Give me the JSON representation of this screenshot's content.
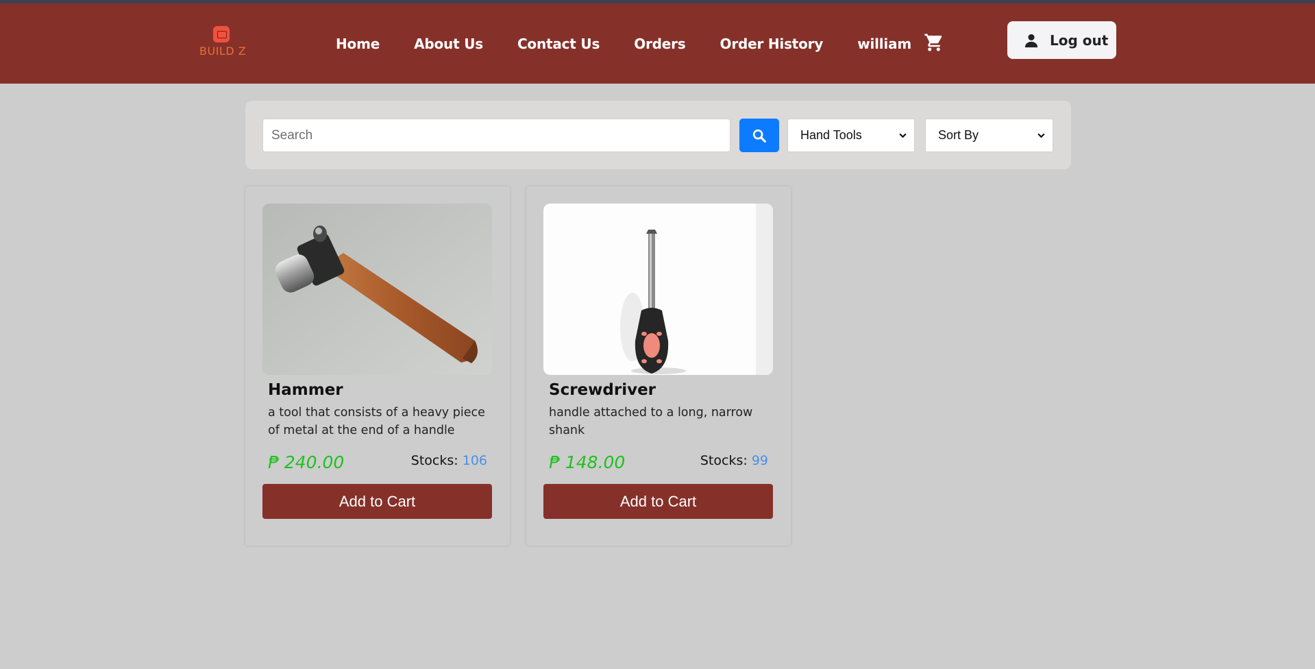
{
  "app": {
    "brand": "BUILD Z",
    "colors": {
      "navbar": "#85312a",
      "background": "#cdcdcd",
      "accent": "#0d7bff",
      "price": "#1fc11f",
      "stock_value": "#4b8fe8"
    }
  },
  "nav": {
    "links": [
      "Home",
      "About Us",
      "Contact Us",
      "Orders",
      "Order History",
      "william"
    ],
    "cart_icon": "cart-icon",
    "logout": {
      "icon": "user-icon",
      "label": "Log out"
    }
  },
  "filters": {
    "search_placeholder": "Search",
    "search_value": "",
    "search_icon": "search-icon",
    "category": "Hand Tools",
    "sort": "Sort By"
  },
  "products": [
    {
      "name": "Hammer",
      "description": "a tool that consists of a heavy piece of metal at the end of a handle",
      "price": "₱ 240.00",
      "stocks_label": "Stocks:",
      "stocks": "106",
      "button": "Add to Cart"
    },
    {
      "name": "Screwdriver",
      "description": "handle attached to a long, narrow shank",
      "price": "₱ 148.00",
      "stocks_label": "Stocks:",
      "stocks": "99",
      "button": "Add to Cart"
    }
  ]
}
